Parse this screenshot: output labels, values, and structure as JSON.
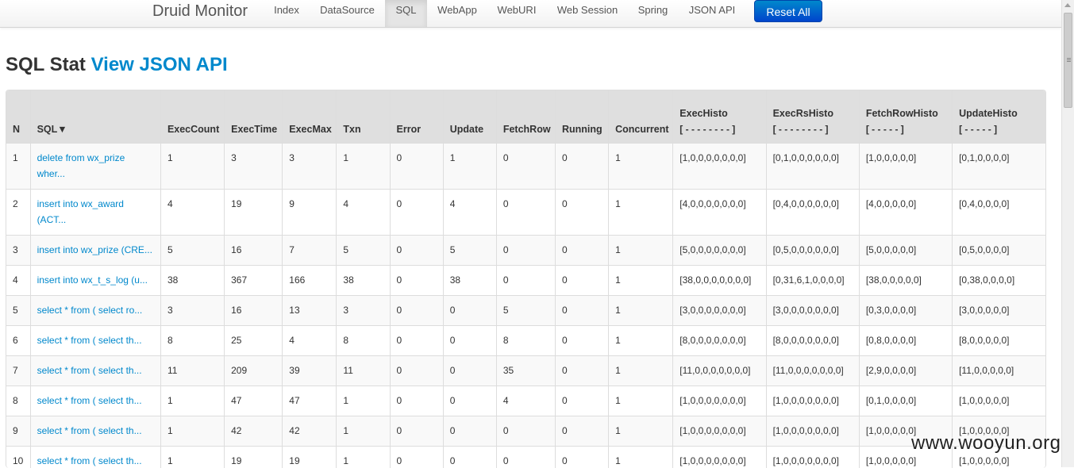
{
  "nav": {
    "brand": "Druid Monitor",
    "items": [
      "Index",
      "DataSource",
      "SQL",
      "WebApp",
      "WebURI",
      "Web Session",
      "Spring",
      "JSON API"
    ],
    "active": "SQL",
    "reset_label": "Reset All"
  },
  "heading": {
    "title": "SQL Stat",
    "link": "View JSON API"
  },
  "table": {
    "headers": {
      "n": "N",
      "sql": "SQL▼",
      "exec_count": "ExecCount",
      "exec_time": "ExecTime",
      "exec_max": "ExecMax",
      "txn": "Txn",
      "error": "Error",
      "update": "Update",
      "fetch_row": "FetchRow",
      "running": "Running",
      "concurrent": "Concurrent",
      "exec_histo": "ExecHisto",
      "exec_histo_sub": "[ - - - - - - - - ]",
      "exec_rs_histo": "ExecRsHisto",
      "exec_rs_histo_sub": "[ - - - - - - - - ]",
      "fetch_row_histo": "FetchRowHisto",
      "fetch_row_histo_sub": "[ - - - - - ]",
      "update_histo": "UpdateHisto",
      "update_histo_sub": "[ - - - - - ]"
    },
    "rows": [
      {
        "n": "1",
        "sql": "delete from wx_prize wher...",
        "exec_count": "1",
        "exec_time": "3",
        "exec_max": "3",
        "txn": "1",
        "error": "0",
        "update": "1",
        "fetch_row": "0",
        "running": "0",
        "concurrent": "1",
        "exec_histo": "[1,0,0,0,0,0,0,0]",
        "exec_rs_histo": "[0,1,0,0,0,0,0,0]",
        "fetch_row_histo": "[1,0,0,0,0,0]",
        "update_histo": "[0,1,0,0,0,0]"
      },
      {
        "n": "2",
        "sql": "insert into wx_award (ACT...",
        "exec_count": "4",
        "exec_time": "19",
        "exec_max": "9",
        "txn": "4",
        "error": "0",
        "update": "4",
        "fetch_row": "0",
        "running": "0",
        "concurrent": "1",
        "exec_histo": "[4,0,0,0,0,0,0,0]",
        "exec_rs_histo": "[0,4,0,0,0,0,0,0]",
        "fetch_row_histo": "[4,0,0,0,0,0]",
        "update_histo": "[0,4,0,0,0,0]"
      },
      {
        "n": "3",
        "sql": "insert into wx_prize (CRE...",
        "exec_count": "5",
        "exec_time": "16",
        "exec_max": "7",
        "txn": "5",
        "error": "0",
        "update": "5",
        "fetch_row": "0",
        "running": "0",
        "concurrent": "1",
        "exec_histo": "[5,0,0,0,0,0,0,0]",
        "exec_rs_histo": "[0,5,0,0,0,0,0,0]",
        "fetch_row_histo": "[5,0,0,0,0,0]",
        "update_histo": "[0,5,0,0,0,0]"
      },
      {
        "n": "4",
        "sql": "insert into wx_t_s_log (u...",
        "exec_count": "38",
        "exec_time": "367",
        "exec_max": "166",
        "txn": "38",
        "error": "0",
        "update": "38",
        "fetch_row": "0",
        "running": "0",
        "concurrent": "1",
        "exec_histo": "[38,0,0,0,0,0,0,0]",
        "exec_rs_histo": "[0,31,6,1,0,0,0,0]",
        "fetch_row_histo": "[38,0,0,0,0,0]",
        "update_histo": "[0,38,0,0,0,0]"
      },
      {
        "n": "5",
        "sql": "select * from ( select ro...",
        "exec_count": "3",
        "exec_time": "16",
        "exec_max": "13",
        "txn": "3",
        "error": "0",
        "update": "0",
        "fetch_row": "5",
        "running": "0",
        "concurrent": "1",
        "exec_histo": "[3,0,0,0,0,0,0,0]",
        "exec_rs_histo": "[3,0,0,0,0,0,0,0]",
        "fetch_row_histo": "[0,3,0,0,0,0]",
        "update_histo": "[3,0,0,0,0,0]"
      },
      {
        "n": "6",
        "sql": "select * from ( select th...",
        "exec_count": "8",
        "exec_time": "25",
        "exec_max": "4",
        "txn": "8",
        "error": "0",
        "update": "0",
        "fetch_row": "8",
        "running": "0",
        "concurrent": "1",
        "exec_histo": "[8,0,0,0,0,0,0,0]",
        "exec_rs_histo": "[8,0,0,0,0,0,0,0]",
        "fetch_row_histo": "[0,8,0,0,0,0]",
        "update_histo": "[8,0,0,0,0,0]"
      },
      {
        "n": "7",
        "sql": "select * from ( select th...",
        "exec_count": "11",
        "exec_time": "209",
        "exec_max": "39",
        "txn": "11",
        "error": "0",
        "update": "0",
        "fetch_row": "35",
        "running": "0",
        "concurrent": "1",
        "exec_histo": "[11,0,0,0,0,0,0,0]",
        "exec_rs_histo": "[11,0,0,0,0,0,0,0]",
        "fetch_row_histo": "[2,9,0,0,0,0]",
        "update_histo": "[11,0,0,0,0,0]"
      },
      {
        "n": "8",
        "sql": "select * from ( select th...",
        "exec_count": "1",
        "exec_time": "47",
        "exec_max": "47",
        "txn": "1",
        "error": "0",
        "update": "0",
        "fetch_row": "4",
        "running": "0",
        "concurrent": "1",
        "exec_histo": "[1,0,0,0,0,0,0,0]",
        "exec_rs_histo": "[1,0,0,0,0,0,0,0]",
        "fetch_row_histo": "[0,1,0,0,0,0]",
        "update_histo": "[1,0,0,0,0,0]"
      },
      {
        "n": "9",
        "sql": "select * from ( select th...",
        "exec_count": "1",
        "exec_time": "42",
        "exec_max": "42",
        "txn": "1",
        "error": "0",
        "update": "0",
        "fetch_row": "0",
        "running": "0",
        "concurrent": "1",
        "exec_histo": "[1,0,0,0,0,0,0,0]",
        "exec_rs_histo": "[1,0,0,0,0,0,0,0]",
        "fetch_row_histo": "[1,0,0,0,0,0]",
        "update_histo": "[1,0,0,0,0,0]"
      },
      {
        "n": "10",
        "sql": "select * from ( select th...",
        "exec_count": "1",
        "exec_time": "19",
        "exec_max": "19",
        "txn": "1",
        "error": "0",
        "update": "0",
        "fetch_row": "0",
        "running": "0",
        "concurrent": "1",
        "exec_histo": "[1,0,0,0,0,0,0,0]",
        "exec_rs_histo": "[1,0,0,0,0,0,0,0]",
        "fetch_row_histo": "[1,0,0,0,0,0]",
        "update_histo": "[1,0,0,0,0,0]"
      }
    ]
  },
  "watermark": "www.wooyun.org"
}
